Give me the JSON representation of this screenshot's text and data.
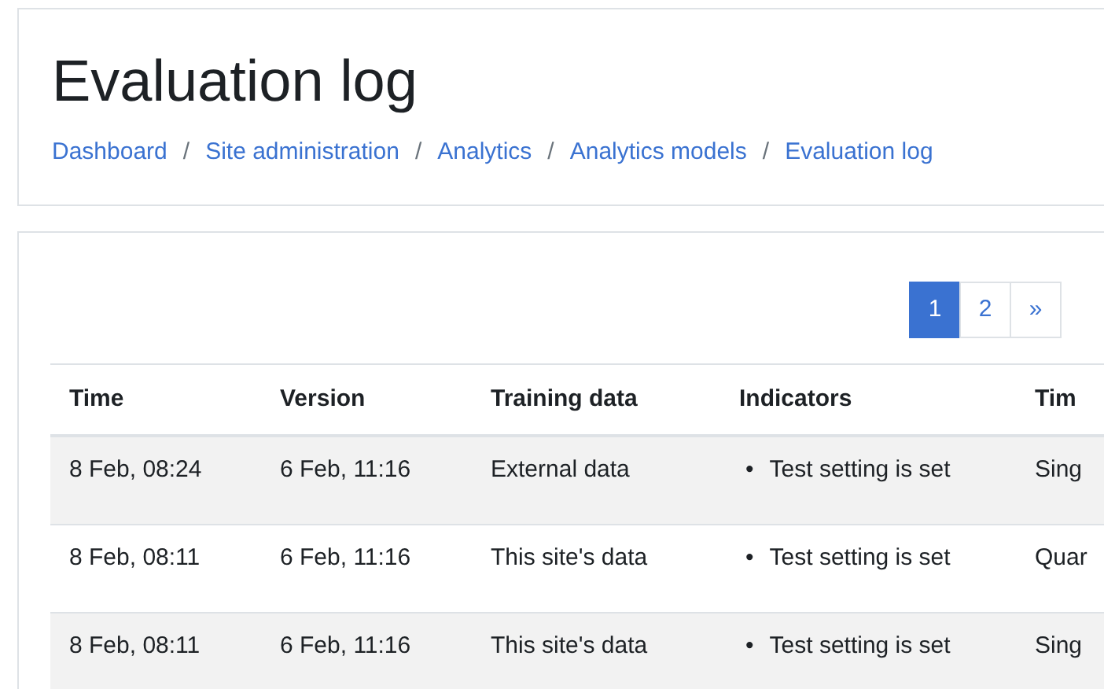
{
  "header": {
    "title": "Evaluation log",
    "breadcrumb": [
      {
        "label": "Dashboard"
      },
      {
        "separator": "/",
        "label": "Site administration"
      },
      {
        "separator": "/",
        "label": "Analytics"
      },
      {
        "separator": "/",
        "label": "Analytics models"
      },
      {
        "separator": "/",
        "label": "Evaluation log"
      }
    ]
  },
  "pagination": [
    {
      "label": "1",
      "selected": true
    },
    {
      "label": "2",
      "selected": false
    },
    {
      "label": "»",
      "selected": false
    }
  ],
  "table": {
    "columns": [
      "Time",
      "Version",
      "Training data",
      "Indicators",
      "Tim"
    ],
    "rows": [
      {
        "time": "8 Feb, 08:24",
        "version": "6 Feb, 11:16",
        "training_data": "External data",
        "indicators": [
          {
            "marker": "•",
            "text": "Test setting is set"
          }
        ],
        "column_5": "Sing"
      },
      {
        "time": "8 Feb, 08:11",
        "version": "6 Feb, 11:16",
        "training_data": "This site's data",
        "indicators": [
          {
            "marker": "•",
            "text": "Test setting is set"
          }
        ],
        "column_5": "Quar"
      },
      {
        "time": "8 Feb, 08:11",
        "version": "6 Feb, 11:16",
        "training_data": "This site's data",
        "indicators": [
          {
            "marker": "•",
            "text": "Test setting is set"
          }
        ],
        "column_5": "Sing"
      }
    ]
  }
}
